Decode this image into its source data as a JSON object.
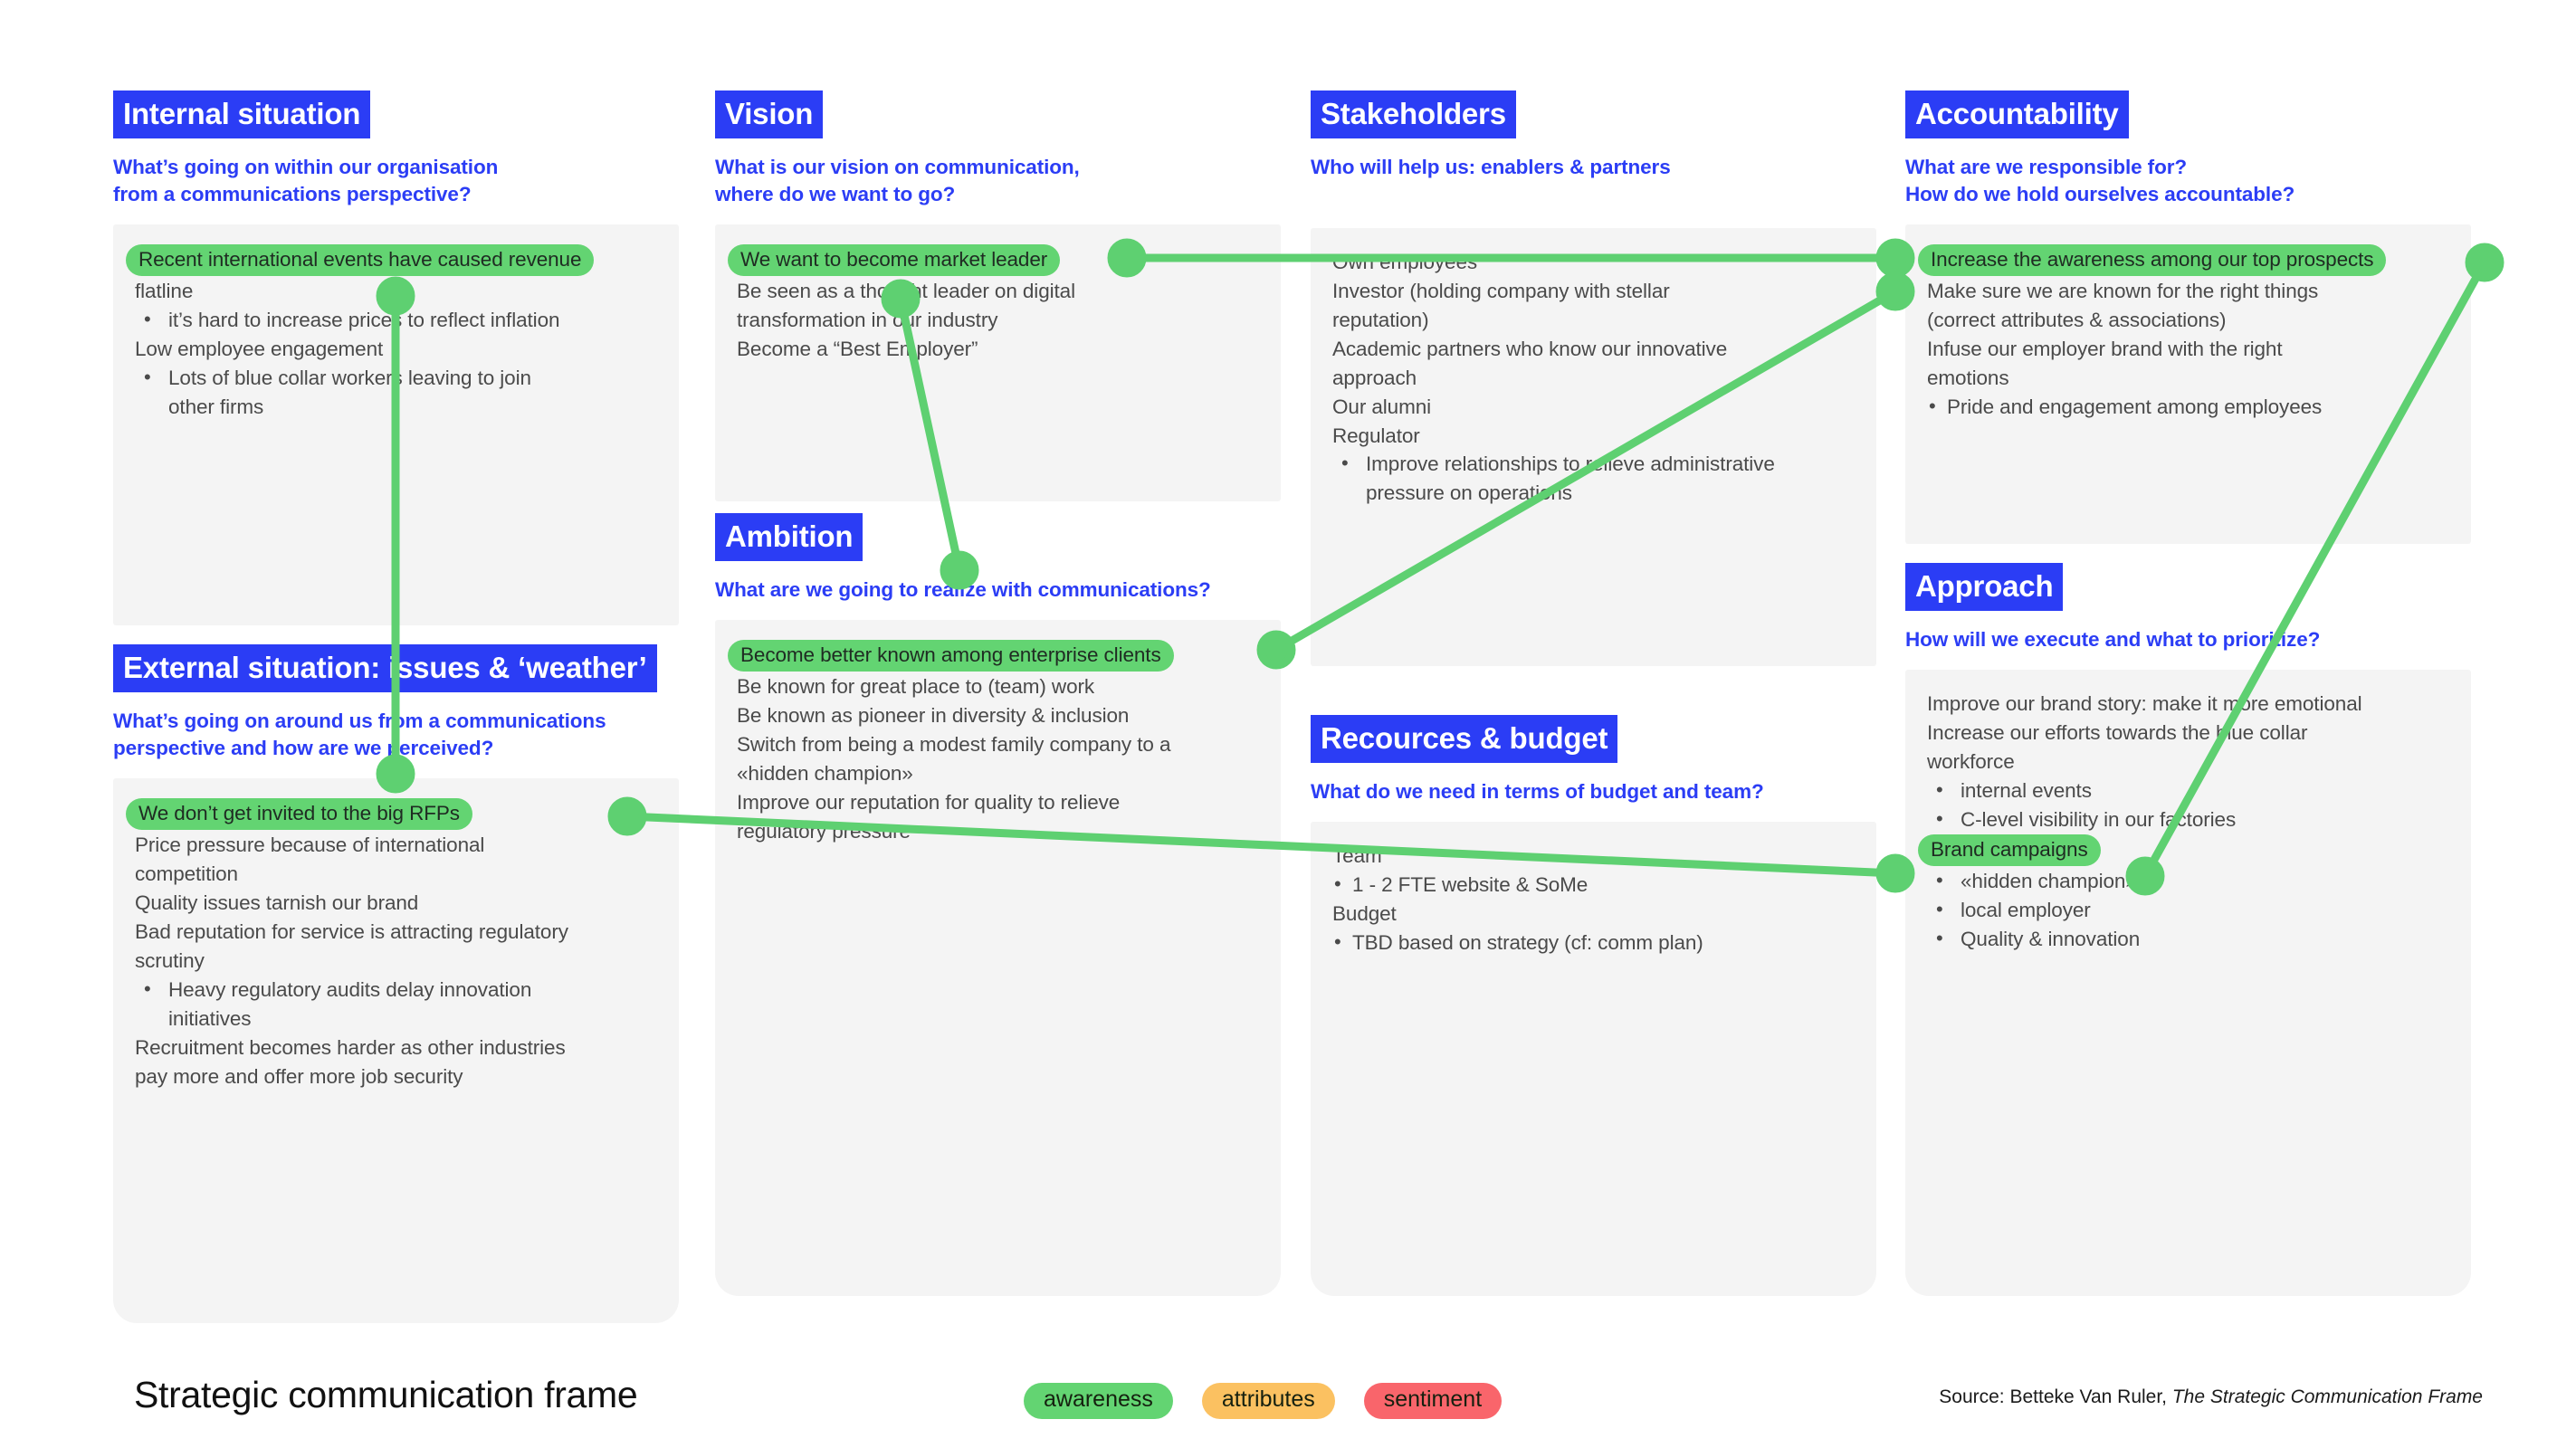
{
  "colors": {
    "header_blue": "#2b3df5",
    "highlight_green": "#63d472",
    "connector_green": "#5ed071",
    "panel_gray": "#f4f4f4",
    "legend_awareness": "#63d472",
    "legend_attributes": "#fbc161",
    "legend_sentiment": "#f9656b"
  },
  "panels": {
    "internal_situation": {
      "title": "Internal situation",
      "question": "What’s going on within our organisation\nfrom a communications perspective?",
      "lines": [
        {
          "text": "Recent international events have caused revenue",
          "style": "highlight"
        },
        {
          "text": "flatline",
          "style": "plain"
        },
        {
          "text": "it’s hard to increase prices to reflect inflation",
          "style": "bullet"
        },
        {
          "text": "Low employee engagement",
          "style": "plain"
        },
        {
          "text": "Lots of blue collar workers leaving to join",
          "style": "bullet"
        },
        {
          "text": "other firms",
          "style": "bullet-cont"
        }
      ]
    },
    "external_situation": {
      "title": "External situation: issues & ‘weather’",
      "question": "What’s going on around us from a communications\nperspective and how are we perceived?",
      "lines": [
        {
          "text": "We don’t get invited to the big RFPs",
          "style": "highlight"
        },
        {
          "text": "Price pressure because of international",
          "style": "plain"
        },
        {
          "text": "competition",
          "style": "plain"
        },
        {
          "text": "Quality issues tarnish our brand",
          "style": "plain"
        },
        {
          "text": "Bad reputation for service is attracting regulatory",
          "style": "plain"
        },
        {
          "text": "scrutiny",
          "style": "plain"
        },
        {
          "text": "Heavy regulatory audits delay innovation",
          "style": "bullet"
        },
        {
          "text": "initiatives",
          "style": "bullet-cont"
        },
        {
          "text": "Recruitment becomes harder as other industries",
          "style": "plain"
        },
        {
          "text": "pay more and offer more job security",
          "style": "plain"
        }
      ]
    },
    "vision": {
      "title": "Vision",
      "question": "What is our vision on communication,\nwhere do we want to go?",
      "lines": [
        {
          "text": "We want to become market leader",
          "style": "highlight"
        },
        {
          "text": "Be seen as a thought leader on digital",
          "style": "plain"
        },
        {
          "text": "transformation in our industry",
          "style": "plain"
        },
        {
          "text": "Become a “Best Employer”",
          "style": "plain"
        }
      ]
    },
    "ambition": {
      "title": "Ambition",
      "question": "What are we going to realize with communications?",
      "lines": [
        {
          "text": "Become better known among enterprise clients",
          "style": "highlight"
        },
        {
          "text": "Be known for great place to (team) work",
          "style": "plain"
        },
        {
          "text": "Be known as pioneer in diversity & inclusion",
          "style": "plain"
        },
        {
          "text": "Switch from being a modest family company to a",
          "style": "plain"
        },
        {
          "text": "«hidden champion»",
          "style": "plain"
        },
        {
          "text": "Improve our reputation for quality to relieve",
          "style": "plain"
        },
        {
          "text": "regulatory pressure",
          "style": "plain"
        }
      ]
    },
    "stakeholders": {
      "title": "Stakeholders",
      "question": "Who will help us: enablers & partners",
      "lines": [
        {
          "text": "Own employees",
          "style": "plain"
        },
        {
          "text": "Investor (holding company with stellar",
          "style": "plain"
        },
        {
          "text": "reputation)",
          "style": "plain"
        },
        {
          "text": "Academic partners who know our innovative",
          "style": "plain"
        },
        {
          "text": "approach",
          "style": "plain"
        },
        {
          "text": "Our alumni",
          "style": "plain"
        },
        {
          "text": "Regulator",
          "style": "plain"
        },
        {
          "text": "Improve relationships to relieve administrative",
          "style": "bullet"
        },
        {
          "text": "pressure on operations",
          "style": "bullet-cont"
        }
      ]
    },
    "resources_budget": {
      "title": "Recources & budget",
      "question": "What do we need in terms of budget and team?",
      "lines": [
        {
          "text": "Team",
          "style": "plain"
        },
        {
          "text": "1 - 2 FTE website & SoMe",
          "style": "bullet-tight"
        },
        {
          "text": "Budget",
          "style": "plain"
        },
        {
          "text": "TBD based on strategy (cf: comm plan)",
          "style": "bullet-tight"
        }
      ]
    },
    "accountability": {
      "title": "Accountability",
      "question": "What are we responsible for?\nHow do we hold ourselves accountable?",
      "lines": [
        {
          "text": "Increase the awareness among our top prospects",
          "style": "highlight"
        },
        {
          "text": "Make sure we are known for the right things",
          "style": "plain"
        },
        {
          "text": "(correct attributes & associations)",
          "style": "plain"
        },
        {
          "text": "Infuse our employer brand with the right",
          "style": "plain"
        },
        {
          "text": "emotions",
          "style": "plain"
        },
        {
          "text": "Pride and engagement among employees",
          "style": "bullet-tight"
        }
      ]
    },
    "approach": {
      "title": "Approach",
      "question": "How will we execute and what to prioritize?",
      "lines": [
        {
          "text": "Improve our brand story: make it more emotional",
          "style": "plain"
        },
        {
          "text": "Increase our efforts towards the blue collar",
          "style": "plain"
        },
        {
          "text": "workforce",
          "style": "plain"
        },
        {
          "text": "internal events",
          "style": "bullet"
        },
        {
          "text": "C-level visibility in our factories",
          "style": "bullet"
        },
        {
          "text": "Brand campaigns",
          "style": "highlight"
        },
        {
          "text": "«hidden champion»",
          "style": "bullet"
        },
        {
          "text": "local employer",
          "style": "bullet"
        },
        {
          "text": "Quality & innovation",
          "style": "bullet"
        }
      ]
    }
  },
  "footer": {
    "title": "Strategic communication frame",
    "legend": [
      {
        "label": "awareness",
        "color": "#63d472"
      },
      {
        "label": "attributes",
        "color": "#fbc161"
      },
      {
        "label": "sentiment",
        "color": "#f9656b"
      }
    ],
    "source_prefix": "Source: Betteke Van Ruler, ",
    "source_title": "The Strategic Communication Frame"
  }
}
